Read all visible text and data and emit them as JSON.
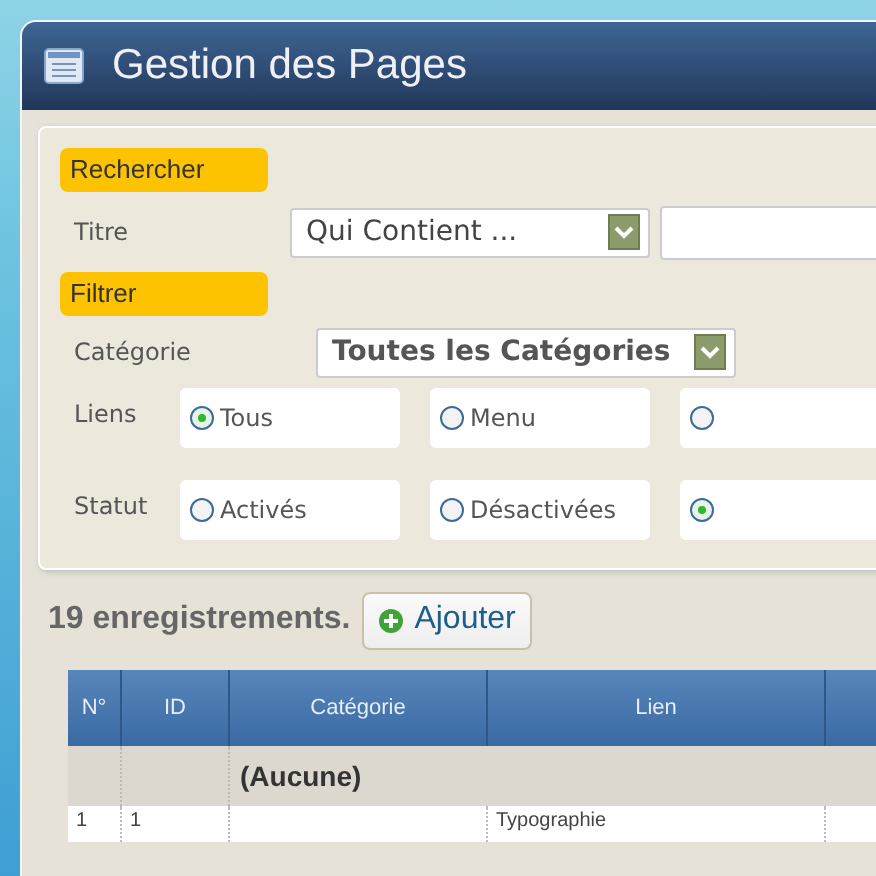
{
  "window": {
    "title": "Gestion des Pages"
  },
  "search": {
    "heading": "Rechercher",
    "field_label": "Titre",
    "operator": "Qui Contient ..."
  },
  "filter": {
    "heading": "Filtrer",
    "category_label": "Catégorie",
    "category": "Toutes les Catégories",
    "groups": [
      {
        "label": "Liens",
        "options": [
          {
            "label": "Tous",
            "selected": true
          },
          {
            "label": "Menu",
            "selected": false
          },
          {
            "selected": false
          }
        ]
      },
      {
        "label": "Statut",
        "options": [
          {
            "label": "Activés",
            "selected": false
          },
          {
            "label": "Désactivées",
            "selected": false
          },
          {
            "selected": true
          }
        ]
      }
    ]
  },
  "count": "19 enregistrements.",
  "add_button": "Ajouter",
  "table": {
    "columns": [
      "N°",
      "ID",
      "Catégorie",
      "Lien",
      ""
    ],
    "group": "(Aucune)",
    "rows": [
      {
        "cells": [
          "1",
          "1",
          "",
          "Typographie",
          ""
        ]
      }
    ]
  }
}
